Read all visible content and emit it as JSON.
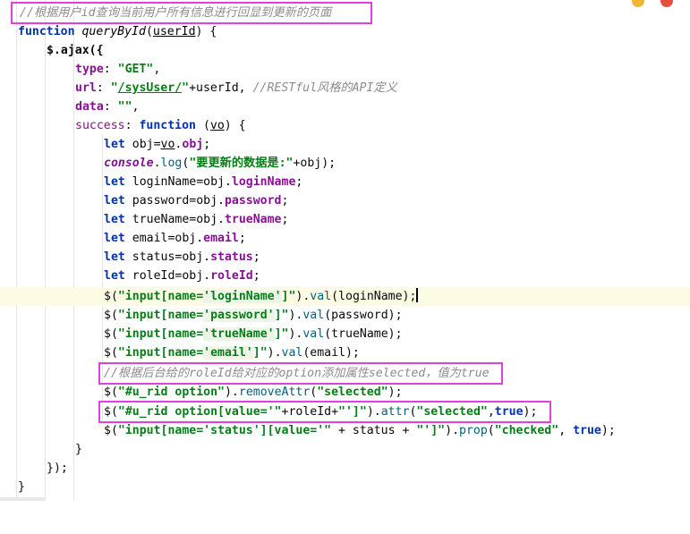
{
  "colors": {
    "keyword": "#0033b3",
    "string": "#067d17",
    "property": "#871094",
    "comment": "#8c8c8c",
    "highlight_box": "#e040e0",
    "current_line": "#fdfbe3"
  },
  "lines": {
    "l1": {
      "comment": "//根据用户id查询当前用户所有信息进行回显到更新的页面"
    },
    "l2": {
      "kw": "function",
      "name": "queryById",
      "open": "(",
      "param": "userId",
      "close": ") {"
    },
    "l3": {
      "text": "$.ajax({"
    },
    "l4": {
      "key": "type",
      "colon": ": ",
      "val": "\"GET\"",
      "tail": ","
    },
    "l5": {
      "key": "url",
      "colon": ": ",
      "q1": "\"",
      "path": "/sysUser/",
      "q2": "\"",
      "tail": "+userId, ",
      "comment": "//RESTful风格的API定义"
    },
    "l6": {
      "key": "data",
      "colon": ": ",
      "val": "\"\"",
      "tail": ","
    },
    "l7": {
      "key": "success",
      "colon": ": ",
      "kw": "function",
      "open": " (",
      "param": "vo",
      "close": ") {"
    },
    "l8": {
      "kw": "let",
      "a": " obj=",
      "b": "vo",
      "c": ".",
      "d": "obj",
      "e": ";"
    },
    "l9": {
      "obj": "console",
      "dot": ".",
      "call": "log",
      "open": "(",
      "str": "\"要更新的数据是:\"",
      "tail": "+obj);"
    },
    "l10": {
      "kw": "let",
      "a": " loginName=obj.",
      "b": "loginName",
      "c": ";"
    },
    "l11": {
      "kw": "let",
      "a": " password=obj.",
      "b": "password",
      "c": ";"
    },
    "l12": {
      "kw": "let",
      "a": " trueName=obj.",
      "b": "trueName",
      "c": ";"
    },
    "l13": {
      "kw": "let",
      "a": " email=obj.",
      "b": "email",
      "c": ";"
    },
    "l14": {
      "kw": "let",
      "a": " status=obj.",
      "b": "status",
      "c": ";"
    },
    "l15": {
      "kw": "let",
      "a": " roleId=obj.",
      "b": "roleId",
      "c": ";"
    },
    "l16": {
      "a": "$(",
      "s1": "\"input[name=",
      "s2": "'loginName'",
      "s3": "]\"",
      "b": ").",
      "call": "val",
      "c": "(loginName);"
    },
    "l17": {
      "a": "$(",
      "s1": "\"input[name=",
      "s2": "'password'",
      "s3": "]\"",
      "b": ").",
      "call": "val",
      "c": "(password);"
    },
    "l18": {
      "a": "$(",
      "s1": "\"input[name=",
      "s2": "'trueName'",
      "s3": "]\"",
      "b": ").",
      "call": "val",
      "c": "(trueName);"
    },
    "l19": {
      "a": "$(",
      "s1": "\"input[name=",
      "s2": "'email'",
      "s3": "]\"",
      "b": ").",
      "call": "val",
      "c": "(email);"
    },
    "l20": {
      "comment": "//根据后台给的roleId给对应的option添加属性selected，值为true"
    },
    "l21": {
      "a": "$(",
      "s1": "\"#u_rid option\"",
      "b": ").",
      "call": "removeAttr",
      "c": "(",
      "s2": "\"selected\"",
      "d": ");"
    },
    "l22": {
      "a": "$(",
      "s1": "\"#u_rid option[value='\"",
      "b": "+roleId+",
      "s2": "\"']\"",
      "c": ").",
      "call": "attr",
      "d": "(",
      "s3": "\"selected\"",
      "e": ",",
      "kw": "true",
      "f": ");"
    },
    "l23": {
      "a": "$(",
      "s1": "\"input[name='status'][value='\"",
      "b": " + status + ",
      "s2": "\"']\"",
      "c": ").",
      "call": "prop",
      "d": "(",
      "s3": "\"checked\"",
      "e": ", ",
      "kw": "true",
      "f": ");"
    },
    "l24": {
      "text": "}"
    },
    "l25": {
      "text": "});"
    },
    "l26": {
      "text": "}"
    }
  }
}
